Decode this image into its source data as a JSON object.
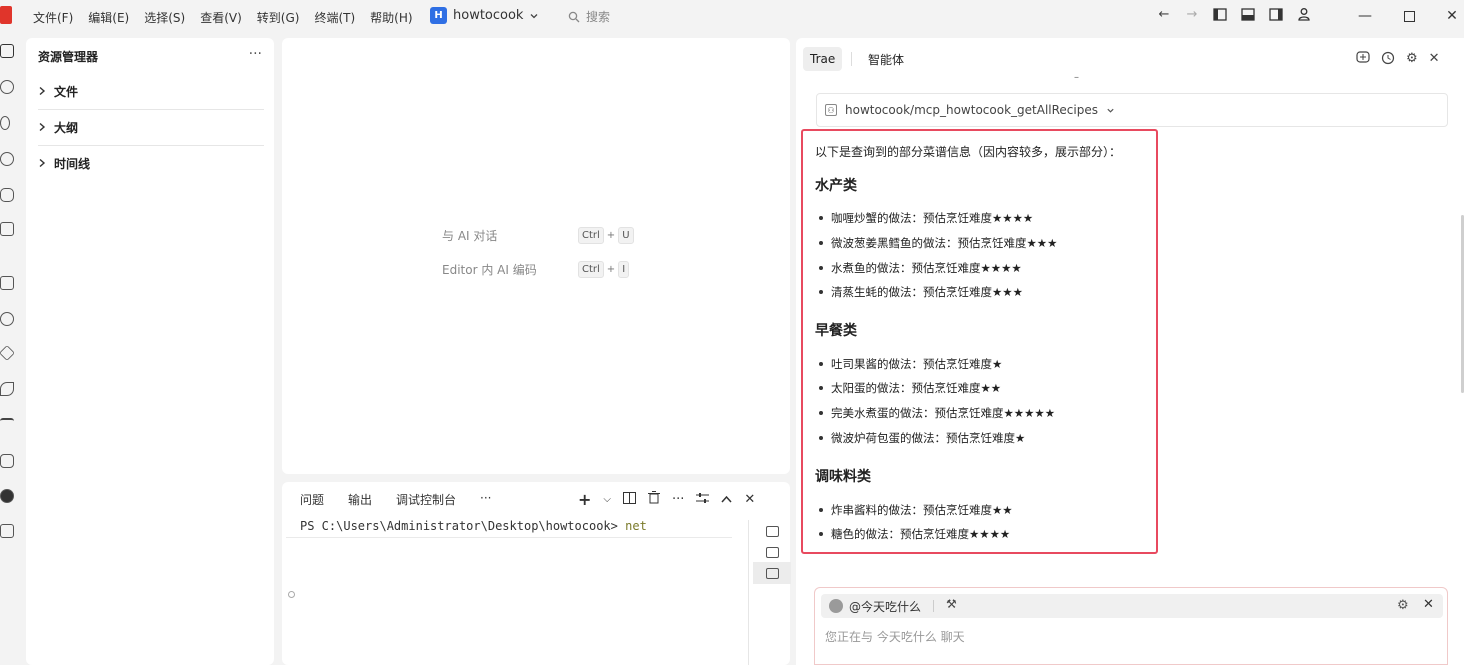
{
  "menu": [
    "文件(F)",
    "编辑(E)",
    "选择(S)",
    "查看(V)",
    "转到(G)",
    "终端(T)",
    "帮助(H)"
  ],
  "project": {
    "badge": "H",
    "name": "howtocook"
  },
  "search": {
    "placeholder": "搜索"
  },
  "explorer": {
    "title": "资源管理器",
    "more": "···",
    "items": [
      {
        "label": "文件"
      },
      {
        "label": "大纲"
      },
      {
        "label": "时间线"
      }
    ]
  },
  "editor": {
    "hints": [
      {
        "label": "与 AI 对话",
        "keys": [
          "Ctrl",
          "U"
        ]
      },
      {
        "label": "Editor 内 AI 编码",
        "keys": [
          "Ctrl",
          "I"
        ]
      }
    ],
    "plus": "+"
  },
  "terminal": {
    "tabs": [
      "问题",
      "输出",
      "调试控制台",
      "···"
    ],
    "prompt": "PS C:\\Users\\Administrator\\Desktop\\howtocook>",
    "command": "net"
  },
  "chat": {
    "tab_active": "Trae",
    "tab_other": "智能体",
    "tool_call": "howtocook/mcp_howtocook_getAllRecipes",
    "intro": "以下是查询到的部分菜谱信息（因内容较多，展示部分）：",
    "sections": [
      {
        "title": "水产类",
        "items": [
          "咖喱炒蟹的做法：预估烹饪难度★★★★",
          "微波葱姜黑鳕鱼的做法：预估烹饪难度★★★",
          "水煮鱼的做法：预估烹饪难度★★★★",
          "清蒸生蚝的做法：预估烹饪难度★★★"
        ]
      },
      {
        "title": "早餐类",
        "items": [
          "吐司果酱的做法：预估烹饪难度★",
          "太阳蛋的做法：预估烹饪难度★★",
          "完美水煮蛋的做法：预估烹饪难度★★★★★",
          "微波炉荷包蛋的做法：预估烹饪难度★"
        ]
      },
      {
        "title": "调味料类",
        "items": [
          "炸串酱料的做法：预估烹饪难度★★",
          "糖色的做法：预估烹饪难度★★★★"
        ]
      }
    ],
    "agent": "@今天吃什么",
    "placeholder": "您正在与 今天吃什么 聊天"
  }
}
